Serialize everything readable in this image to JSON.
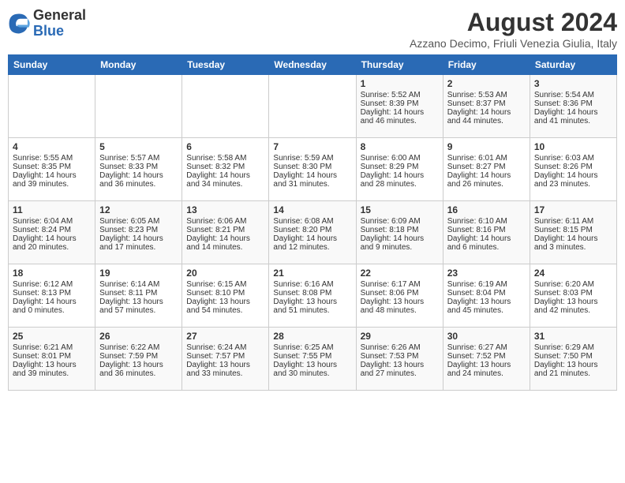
{
  "logo": {
    "line1": "General",
    "line2": "Blue"
  },
  "title": "August 2024",
  "subtitle": "Azzano Decimo, Friuli Venezia Giulia, Italy",
  "days_of_week": [
    "Sunday",
    "Monday",
    "Tuesday",
    "Wednesday",
    "Thursday",
    "Friday",
    "Saturday"
  ],
  "weeks": [
    {
      "class": "row1",
      "days": [
        {
          "num": "",
          "info": ""
        },
        {
          "num": "",
          "info": ""
        },
        {
          "num": "",
          "info": ""
        },
        {
          "num": "",
          "info": ""
        },
        {
          "num": "1",
          "info": "Sunrise: 5:52 AM\nSunset: 8:39 PM\nDaylight: 14 hours and 46 minutes."
        },
        {
          "num": "2",
          "info": "Sunrise: 5:53 AM\nSunset: 8:37 PM\nDaylight: 14 hours and 44 minutes."
        },
        {
          "num": "3",
          "info": "Sunrise: 5:54 AM\nSunset: 8:36 PM\nDaylight: 14 hours and 41 minutes."
        }
      ]
    },
    {
      "class": "row2",
      "days": [
        {
          "num": "4",
          "info": "Sunrise: 5:55 AM\nSunset: 8:35 PM\nDaylight: 14 hours and 39 minutes."
        },
        {
          "num": "5",
          "info": "Sunrise: 5:57 AM\nSunset: 8:33 PM\nDaylight: 14 hours and 36 minutes."
        },
        {
          "num": "6",
          "info": "Sunrise: 5:58 AM\nSunset: 8:32 PM\nDaylight: 14 hours and 34 minutes."
        },
        {
          "num": "7",
          "info": "Sunrise: 5:59 AM\nSunset: 8:30 PM\nDaylight: 14 hours and 31 minutes."
        },
        {
          "num": "8",
          "info": "Sunrise: 6:00 AM\nSunset: 8:29 PM\nDaylight: 14 hours and 28 minutes."
        },
        {
          "num": "9",
          "info": "Sunrise: 6:01 AM\nSunset: 8:27 PM\nDaylight: 14 hours and 26 minutes."
        },
        {
          "num": "10",
          "info": "Sunrise: 6:03 AM\nSunset: 8:26 PM\nDaylight: 14 hours and 23 minutes."
        }
      ]
    },
    {
      "class": "row3",
      "days": [
        {
          "num": "11",
          "info": "Sunrise: 6:04 AM\nSunset: 8:24 PM\nDaylight: 14 hours and 20 minutes."
        },
        {
          "num": "12",
          "info": "Sunrise: 6:05 AM\nSunset: 8:23 PM\nDaylight: 14 hours and 17 minutes."
        },
        {
          "num": "13",
          "info": "Sunrise: 6:06 AM\nSunset: 8:21 PM\nDaylight: 14 hours and 14 minutes."
        },
        {
          "num": "14",
          "info": "Sunrise: 6:08 AM\nSunset: 8:20 PM\nDaylight: 14 hours and 12 minutes."
        },
        {
          "num": "15",
          "info": "Sunrise: 6:09 AM\nSunset: 8:18 PM\nDaylight: 14 hours and 9 minutes."
        },
        {
          "num": "16",
          "info": "Sunrise: 6:10 AM\nSunset: 8:16 PM\nDaylight: 14 hours and 6 minutes."
        },
        {
          "num": "17",
          "info": "Sunrise: 6:11 AM\nSunset: 8:15 PM\nDaylight: 14 hours and 3 minutes."
        }
      ]
    },
    {
      "class": "row4",
      "days": [
        {
          "num": "18",
          "info": "Sunrise: 6:12 AM\nSunset: 8:13 PM\nDaylight: 14 hours and 0 minutes."
        },
        {
          "num": "19",
          "info": "Sunrise: 6:14 AM\nSunset: 8:11 PM\nDaylight: 13 hours and 57 minutes."
        },
        {
          "num": "20",
          "info": "Sunrise: 6:15 AM\nSunset: 8:10 PM\nDaylight: 13 hours and 54 minutes."
        },
        {
          "num": "21",
          "info": "Sunrise: 6:16 AM\nSunset: 8:08 PM\nDaylight: 13 hours and 51 minutes."
        },
        {
          "num": "22",
          "info": "Sunrise: 6:17 AM\nSunset: 8:06 PM\nDaylight: 13 hours and 48 minutes."
        },
        {
          "num": "23",
          "info": "Sunrise: 6:19 AM\nSunset: 8:04 PM\nDaylight: 13 hours and 45 minutes."
        },
        {
          "num": "24",
          "info": "Sunrise: 6:20 AM\nSunset: 8:03 PM\nDaylight: 13 hours and 42 minutes."
        }
      ]
    },
    {
      "class": "row5",
      "days": [
        {
          "num": "25",
          "info": "Sunrise: 6:21 AM\nSunset: 8:01 PM\nDaylight: 13 hours and 39 minutes."
        },
        {
          "num": "26",
          "info": "Sunrise: 6:22 AM\nSunset: 7:59 PM\nDaylight: 13 hours and 36 minutes."
        },
        {
          "num": "27",
          "info": "Sunrise: 6:24 AM\nSunset: 7:57 PM\nDaylight: 13 hours and 33 minutes."
        },
        {
          "num": "28",
          "info": "Sunrise: 6:25 AM\nSunset: 7:55 PM\nDaylight: 13 hours and 30 minutes."
        },
        {
          "num": "29",
          "info": "Sunrise: 6:26 AM\nSunset: 7:53 PM\nDaylight: 13 hours and 27 minutes."
        },
        {
          "num": "30",
          "info": "Sunrise: 6:27 AM\nSunset: 7:52 PM\nDaylight: 13 hours and 24 minutes."
        },
        {
          "num": "31",
          "info": "Sunrise: 6:29 AM\nSunset: 7:50 PM\nDaylight: 13 hours and 21 minutes."
        }
      ]
    }
  ]
}
